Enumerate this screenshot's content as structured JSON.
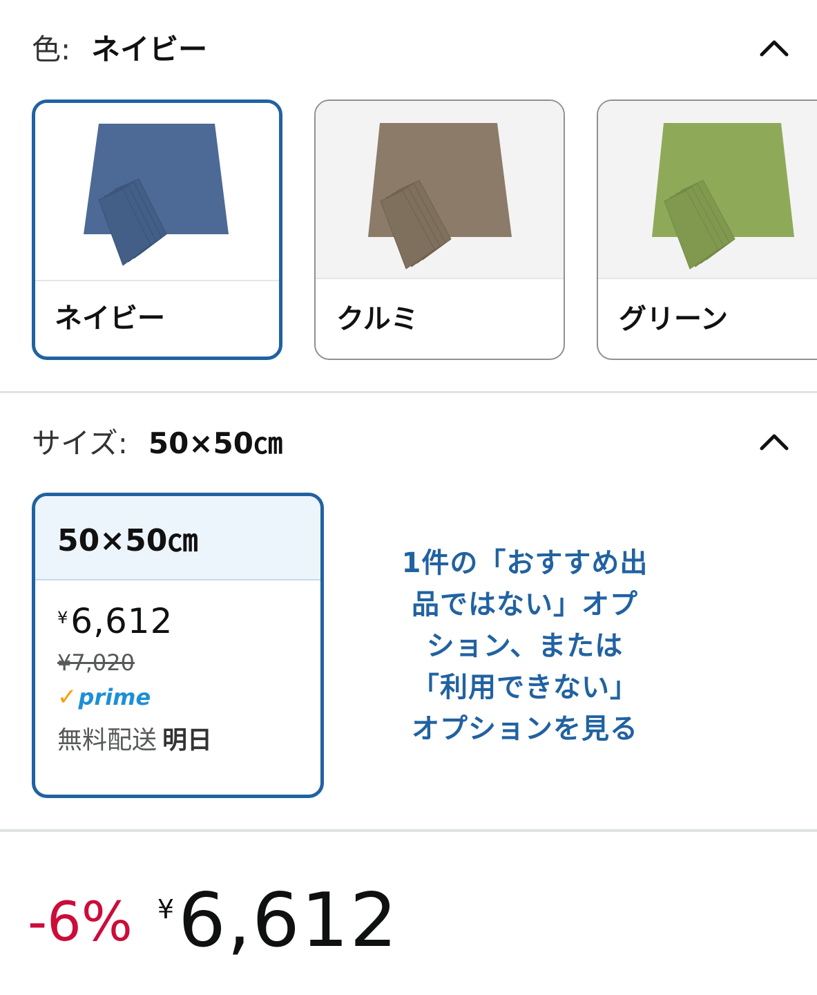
{
  "color_section": {
    "label": "色:",
    "selected_value": "ネイビー",
    "options": [
      {
        "label": "ネイビー",
        "selected": true,
        "color": "#4d6a96"
      },
      {
        "label": "クルミ",
        "selected": false,
        "color": "#8c7b68"
      },
      {
        "label": "グリーン",
        "selected": false,
        "color": "#8eaa58"
      }
    ]
  },
  "size_section": {
    "label": "サイズ:",
    "selected_value": "50×50㎝",
    "option": {
      "title": "50×50㎝",
      "currency": "¥",
      "price": "6,612",
      "list_price": "¥7,020",
      "prime": "prime",
      "delivery_label": "無料配送",
      "delivery_day": "明日"
    },
    "see_more_lines": [
      "1件の「おすすめ出",
      "品ではない」オプ",
      "ション、または",
      "「利用できない」",
      "オプションを見る"
    ]
  },
  "price_summary": {
    "discount": "-6%",
    "currency": "¥",
    "price": "6,612"
  },
  "colors": {
    "accent": "#2162a1",
    "discount": "#cc0c39",
    "prime_check": "#f7a000",
    "prime_text": "#1e8fd6"
  }
}
